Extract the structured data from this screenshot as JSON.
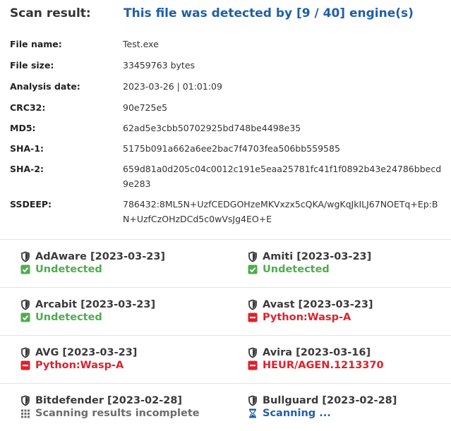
{
  "header": {
    "title": "Scan result:",
    "summary": "This file was detected by [9 / 40] engine(s)"
  },
  "details": [
    {
      "label": "File name:",
      "value": "Test.exe"
    },
    {
      "label": "File size:",
      "value": "33459763 bytes"
    },
    {
      "label": "Analysis date:",
      "value": "2023-03-26 | 01:01:09"
    },
    {
      "label": "CRC32:",
      "value": "90e725e5"
    },
    {
      "label": "MD5:",
      "value": "62ad5e3cbb50702925bd748be4498e35"
    },
    {
      "label": "SHA-1:",
      "value": "5175b091a662a6ee2bac7f4703fea506bb559585"
    },
    {
      "label": "SHA-2:",
      "value": "659d81a0d205c04c0012c191e5eaa25781fc41f1f0892b43e24786bbecd9e283"
    },
    {
      "label": "SSDEEP:",
      "value": "786432:8ML5N+UzfCEDGOHzeMKVxzx5cQKA/wgKqJkILJ67NOETq+Ep:BN+UzfCzOHzDCd5c0wVsJg4EO+E"
    }
  ],
  "engines": [
    {
      "name": "AdAware [2023-03-23]",
      "result": "Undetected",
      "status": "clean",
      "status_icon": "check-icon"
    },
    {
      "name": "Amiti [2023-03-23]",
      "result": "Undetected",
      "status": "clean",
      "status_icon": "check-icon"
    },
    {
      "name": "Arcabit [2023-03-23]",
      "result": "Undetected",
      "status": "clean",
      "status_icon": "check-icon"
    },
    {
      "name": "Avast [2023-03-23]",
      "result": "Python:Wasp-A",
      "status": "threat",
      "status_icon": "minus-icon"
    },
    {
      "name": "AVG [2023-03-23]",
      "result": "Python:Wasp-A",
      "status": "threat",
      "status_icon": "minus-icon"
    },
    {
      "name": "Avira [2023-03-16]",
      "result": "HEUR/AGEN.1213370",
      "status": "threat",
      "status_icon": "minus-icon"
    },
    {
      "name": "Bitdefender [2023-02-28]",
      "result": "Scanning results incomplete",
      "status": "incomplete",
      "status_icon": "grid-icon"
    },
    {
      "name": "Bullguard [2023-02-28]",
      "result": "Scanning ...",
      "status": "scanning",
      "status_icon": "hourglass-icon"
    }
  ],
  "colors": {
    "accent_blue": "#1f5fa6",
    "clean_green": "#4cae4c",
    "threat_red": "#e0202a",
    "incomplete_gray": "#6d6d6d"
  }
}
